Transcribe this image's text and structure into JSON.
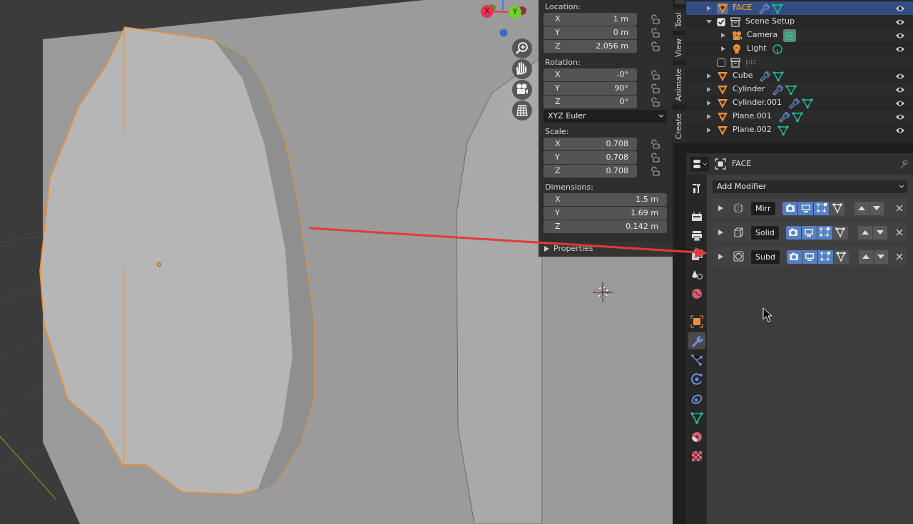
{
  "viewport": {
    "gizmo": [
      {
        "label": "X",
        "color": "#e8304a"
      },
      {
        "label": "Y",
        "color": "#6fd32a"
      }
    ]
  },
  "sidebar": {
    "sections": [
      {
        "label": "Location:",
        "kind": "lockable",
        "fields": [
          {
            "axis": "X",
            "value": "1 m"
          },
          {
            "axis": "Y",
            "value": "0 m"
          },
          {
            "axis": "Z",
            "value": "2.056 m"
          }
        ]
      },
      {
        "label": "Rotation:",
        "kind": "lockable",
        "fields": [
          {
            "axis": "X",
            "value": "-0°"
          },
          {
            "axis": "Y",
            "value": "90°"
          },
          {
            "axis": "Z",
            "value": "0°"
          }
        ],
        "mode": "XYZ Euler"
      },
      {
        "label": "Scale:",
        "kind": "lockable",
        "fields": [
          {
            "axis": "X",
            "value": "0.708"
          },
          {
            "axis": "Y",
            "value": "0.708"
          },
          {
            "axis": "Z",
            "value": "0.708"
          }
        ]
      },
      {
        "label": "Dimensions:",
        "kind": "plain",
        "fields": [
          {
            "axis": "X",
            "value": "1.5 m"
          },
          {
            "axis": "Y",
            "value": "1.69 m"
          },
          {
            "axis": "Z",
            "value": "0.142 m"
          }
        ]
      }
    ],
    "subpanel": {
      "label": "Properties",
      "expanded": false
    },
    "tabs": [
      {
        "label": "Tool",
        "selected": false
      },
      {
        "label": "View",
        "selected": false
      },
      {
        "label": "Animate",
        "selected": false
      },
      {
        "label": "Create",
        "selected": false
      }
    ]
  },
  "outliner": {
    "rows": [
      {
        "name": "FACE",
        "kind": "mesh",
        "selected": true,
        "modifier": true,
        "has_data": true,
        "visible": true
      },
      {
        "name": "Scene Setup",
        "kind": "collection",
        "selected": false,
        "expanded": true,
        "checked": true,
        "visible": true,
        "children": [
          {
            "name": "Camera",
            "kind": "camera",
            "selected": false,
            "modifier": false,
            "has_data": true,
            "visible": true
          },
          {
            "name": "Light",
            "kind": "light",
            "selected": false,
            "modifier": false,
            "has_data": true,
            "visible": true
          }
        ]
      },
      {
        "name": "pic",
        "kind": "collection",
        "selected": false,
        "checked": false,
        "visible": false
      },
      {
        "name": "Cube",
        "kind": "mesh",
        "selected": false,
        "modifier": true,
        "has_data": true,
        "visible": true
      },
      {
        "name": "Cylinder",
        "kind": "mesh",
        "selected": false,
        "modifier": true,
        "has_data": true,
        "visible": true
      },
      {
        "name": "Cylinder.001",
        "kind": "mesh",
        "selected": false,
        "modifier": true,
        "has_data": true,
        "visible": true
      },
      {
        "name": "Plane.001",
        "kind": "mesh",
        "selected": false,
        "modifier": true,
        "has_data": true,
        "visible": true
      },
      {
        "name": "Plane.002",
        "kind": "mesh",
        "selected": false,
        "modifier": false,
        "has_data": true,
        "visible": true
      }
    ]
  },
  "properties": {
    "object_name": "FACE",
    "tabs": [
      {
        "kind": "tool",
        "selected": false
      },
      {
        "kind": "render",
        "selected": false
      },
      {
        "kind": "output",
        "selected": false
      },
      {
        "kind": "view_layer",
        "selected": false
      },
      {
        "kind": "scene",
        "selected": false
      },
      {
        "kind": "world",
        "selected": false
      },
      {
        "kind": "object",
        "selected": false
      },
      {
        "kind": "modifiers",
        "selected": true
      },
      {
        "kind": "particles",
        "selected": false
      },
      {
        "kind": "physics",
        "selected": false
      },
      {
        "kind": "constraints",
        "selected": false
      },
      {
        "kind": "data",
        "selected": false
      },
      {
        "kind": "material",
        "selected": false
      },
      {
        "kind": "texture",
        "selected": false
      }
    ],
    "add_modifier": "Add Modifier",
    "modifiers": [
      {
        "name": "Mirr",
        "kind": "mirror",
        "expanded": false,
        "render": true,
        "viewport": true,
        "editmode": true,
        "cage": false
      },
      {
        "name": "Solid",
        "kind": "solidify",
        "expanded": false,
        "render": true,
        "viewport": true,
        "editmode": true,
        "cage": false
      },
      {
        "name": "Subd",
        "kind": "subsurf",
        "expanded": false,
        "render": true,
        "viewport": true,
        "editmode": true,
        "cage": false
      }
    ]
  }
}
